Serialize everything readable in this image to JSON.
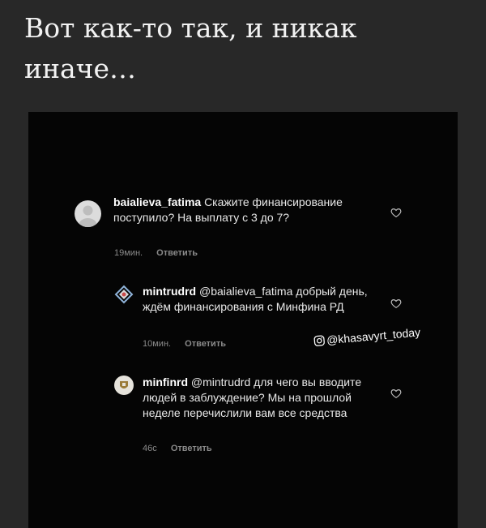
{
  "heading": "Вот как-то так, и никак иначе…",
  "comments": [
    {
      "user": "baialieva_fatima",
      "text": "Скажите финансирование поступило? На выплату с 3 до 7?",
      "time": "19мин.",
      "reply": "Ответить"
    },
    {
      "user": "mintrudrd",
      "text": "@baialieva_fatima добрый день, ждём финансирования с Минфина РД",
      "time": "10мин.",
      "reply": "Ответить"
    },
    {
      "user": "minfinrd",
      "text": "@mintrudrd для чего вы вводите людей в заблуждение? Мы на прошлой неделе перечислили вам все средства",
      "time": "46с",
      "reply": "Ответить"
    }
  ],
  "watermark": "@khasavyrt_today",
  "icons": {
    "like": "heart-icon",
    "watermark": "instagram-icon"
  }
}
